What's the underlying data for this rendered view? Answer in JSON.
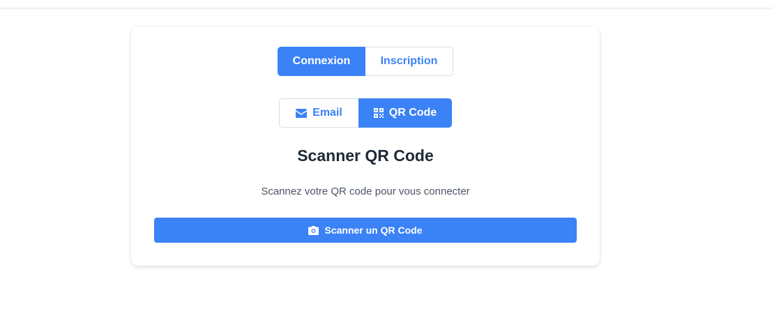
{
  "auth_tabs": {
    "login_label": "Connexion",
    "signup_label": "Inscription",
    "active": "login"
  },
  "method_tabs": {
    "email_label": "Email",
    "qr_label": "QR Code",
    "email_icon": "envelope-icon",
    "qr_icon": "qrcode-icon",
    "active": "qr"
  },
  "panel": {
    "title": "Scanner QR Code",
    "subtitle": "Scannez votre QR code pour vous connecter",
    "scan_button_label": "Scanner un QR Code",
    "scan_button_icon": "camera-icon"
  },
  "colors": {
    "accent": "#3b82f6",
    "text_dark": "#1f2937",
    "text_muted": "#4b5563"
  }
}
